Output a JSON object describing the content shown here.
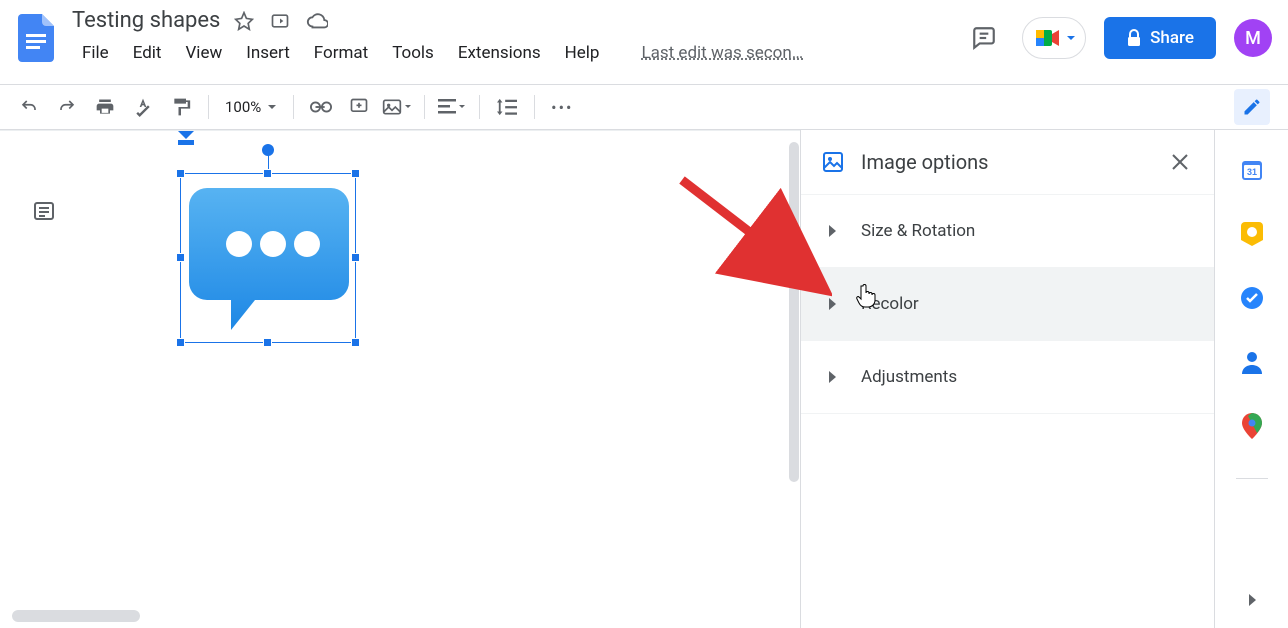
{
  "doc": {
    "title": "Testing shapes"
  },
  "menus": {
    "file": "File",
    "edit": "Edit",
    "view": "View",
    "insert": "Insert",
    "format": "Format",
    "tools": "Tools",
    "extensions": "Extensions",
    "help": "Help"
  },
  "last_edit": "Last edit was secon…",
  "share_label": "Share",
  "avatar_letter": "M",
  "zoom": "100%",
  "panel": {
    "title": "Image options",
    "sections": {
      "size_rotation": "Size & Rotation",
      "recolor": "Recolor",
      "adjustments": "Adjustments"
    }
  }
}
